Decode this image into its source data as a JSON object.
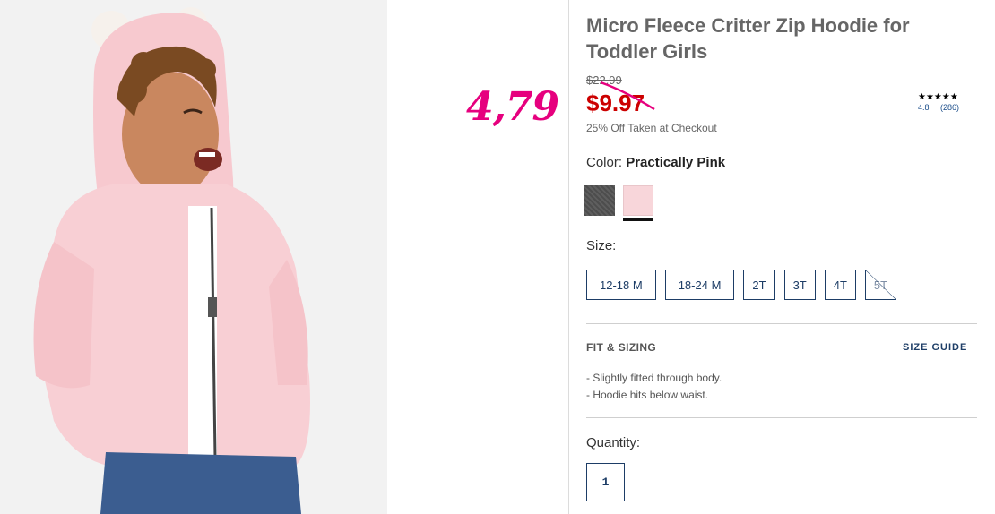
{
  "overlay": {
    "price_note": "4,79"
  },
  "product": {
    "title": "Micro Fleece Critter Zip Hoodie for Toddler Girls",
    "original_price": "$22.99",
    "sale_price": "$9.97",
    "discount_note": "25% Off Taken at Checkout",
    "rating": {
      "stars": "★★★★★",
      "score": "4.8",
      "count": "(286)"
    },
    "color": {
      "label": "Color:",
      "value": "Practically Pink",
      "swatches": [
        "charcoal",
        "pink"
      ]
    },
    "size": {
      "label": "Size:",
      "options": [
        "12-18 M",
        "18-24 M",
        "2T",
        "3T",
        "4T",
        "5T"
      ]
    },
    "fit": {
      "title": "FIT & SIZING",
      "size_guide": "SIZE GUIDE",
      "notes": [
        "Slightly fitted through body.",
        "Hoodie hits below waist."
      ]
    },
    "quantity": {
      "label": "Quantity:",
      "value": "1"
    }
  },
  "colors": {
    "sale_red": "#cc0000",
    "overlay_magenta": "#e6007e",
    "navy": "#1d3d66"
  }
}
